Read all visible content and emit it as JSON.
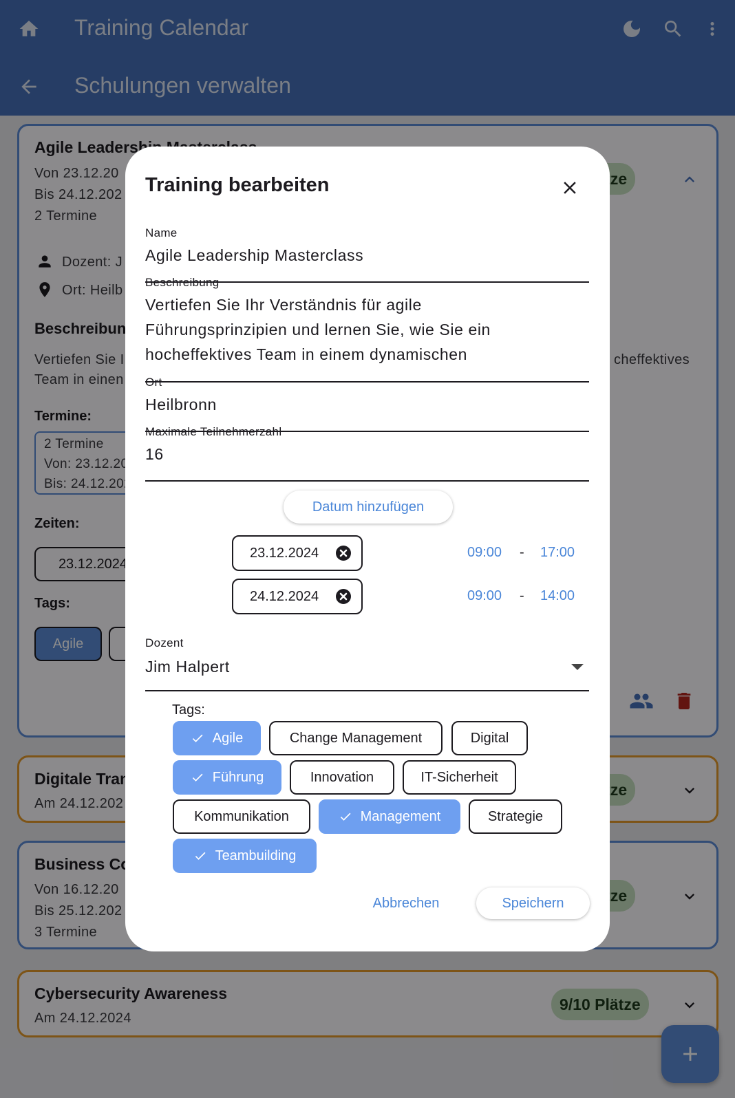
{
  "appbar": {
    "title": "Training Calendar",
    "subtitle": "Schulungen verwalten",
    "icons": [
      "home-icon",
      "dark-mode-icon",
      "search-icon",
      "more-vert-icon",
      "back-arrow-icon"
    ]
  },
  "colors": {
    "primary": "#4670b8",
    "accent": "#4a86d8",
    "selected_chip": "#6e9ff0",
    "badge_bg": "#c5dfc0",
    "card_border_blue": "#5b8ad6",
    "card_border_orange": "#e49a2a",
    "delete_red": "#b3261e"
  },
  "background": {
    "card1": {
      "title": "Agile Leadership Masterclass",
      "from": "Von 23.12.20",
      "to": "Bis 24.12.202",
      "count": "2 Termine",
      "badge": "lätze",
      "lecturer": "Dozent: J",
      "location": "Ort: Heilb",
      "desc_heading": "Beschreibun",
      "desc_line1": "Vertiefen Sie I",
      "desc_line1_right": "cheffektives",
      "desc_line2": "Team in einen",
      "dates_heading": "Termine:",
      "dates_box_line1": "2 Termine",
      "dates_box_line2": "Von: 23.12.20",
      "dates_box_line3": "Bis: 24.12.202",
      "times_heading": "Zeiten:",
      "time_chip": "23.12.2024",
      "tags_heading": "Tags:",
      "tag1": "Agile"
    },
    "card2": {
      "title": "Digitale Tran",
      "date": "Am 24.12.202",
      "badge": "lätze"
    },
    "card3": {
      "title": "Business Co",
      "from": "Von 16.12.20",
      "to": "Bis 25.12.202",
      "count": "3 Termine",
      "badge": "lätze"
    },
    "card4": {
      "title": "Cybersecurity Awareness",
      "date": "Am 24.12.2024",
      "badge": "9/10 Plätze"
    }
  },
  "dialog": {
    "title": "Training bearbeiten",
    "name_label": "Name",
    "name_value": "Agile Leadership Masterclass",
    "desc_label": "Beschreibung",
    "desc_line1": "Vertiefen Sie Ihr Verständnis für agile",
    "desc_line2": "Führungsprinzipien und lernen Sie, wie Sie ein",
    "desc_line3": "hocheffektives Team in einem dynamischen",
    "ort_label": "Ort",
    "ort_value": "Heilbronn",
    "max_label": "Maximale Teilnehmerzahl",
    "max_value": "16",
    "add_date": "Datum hinzufügen",
    "dates": [
      {
        "date": "23.12.2024",
        "start": "09:00",
        "sep": "-",
        "end": "17:00"
      },
      {
        "date": "24.12.2024",
        "start": "09:00",
        "sep": "-",
        "end": "14:00"
      }
    ],
    "dozent_label": "Dozent",
    "dozent_value": "Jim Halpert",
    "tags_label": "Tags:",
    "tags": [
      {
        "label": "Agile",
        "selected": true
      },
      {
        "label": "Change Management",
        "selected": false
      },
      {
        "label": "Digital",
        "selected": false
      },
      {
        "label": "Führung",
        "selected": true
      },
      {
        "label": "Innovation",
        "selected": false
      },
      {
        "label": "IT-Sicherheit",
        "selected": false
      },
      {
        "label": "Kommunikation",
        "selected": false
      },
      {
        "label": "Management",
        "selected": true
      },
      {
        "label": "Strategie",
        "selected": false
      },
      {
        "label": "Teambuilding",
        "selected": true
      }
    ],
    "cancel": "Abbrechen",
    "save": "Speichern"
  }
}
